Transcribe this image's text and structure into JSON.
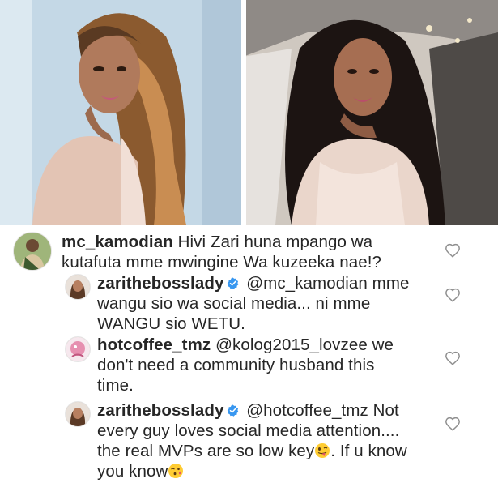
{
  "comments": [
    {
      "username": "mc_kamodian",
      "verified": false,
      "lines": [
        "Hivi Zari huna mpango wa",
        "kutafuta mme mwingine Wa kuzeeka nae!?"
      ]
    },
    {
      "username": "zarithebosslady",
      "verified": true,
      "lines": [
        "@mc_kamodian mme",
        "wangu sio wa social media... ni mme",
        "WANGU sio WETU."
      ]
    },
    {
      "username": "hotcoffee_tmz",
      "verified": false,
      "lines": [
        "@kolog2015_lovzee we",
        "don't need a community husband this",
        "time."
      ]
    },
    {
      "username": "zarithebosslady",
      "verified": true,
      "lines": [
        "@hotcoffee_tmz Not",
        "every guy loves social media attention....",
        "the real MVPs are so low key",
        ". If u know",
        "you know"
      ]
    }
  ],
  "icons": {
    "like": "heart-icon",
    "verified": "verified-badge-icon",
    "emoji1": "silly-face-emoji",
    "emoji2": "kissing-face-emoji"
  },
  "colors": {
    "text": "#262626",
    "verified": "#3897f0",
    "heart": "#8e8e8e"
  }
}
